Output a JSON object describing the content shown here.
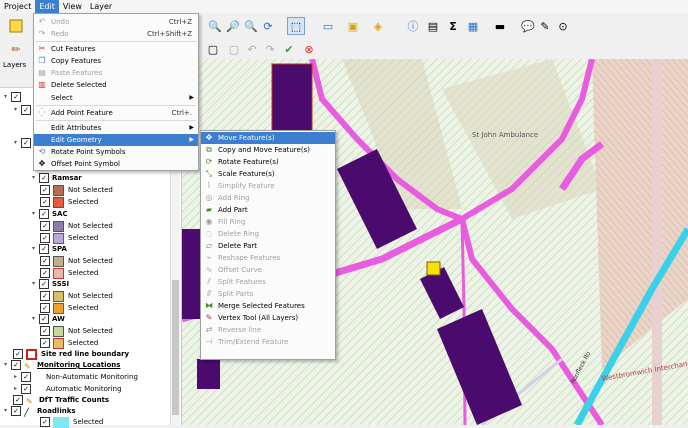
{
  "menubar": {
    "items": [
      "Project",
      "Edit",
      "View",
      "Layer"
    ]
  },
  "edit_menu": {
    "items": [
      {
        "label": "Undo",
        "shortcut": "Ctrl+Z"
      },
      {
        "label": "Redo",
        "shortcut": "Ctrl+Shift+Z"
      },
      {
        "label": "Cut Features",
        "shortcut": ""
      },
      {
        "label": "Copy Features",
        "shortcut": ""
      },
      {
        "label": "Paste Features",
        "shortcut": ""
      },
      {
        "label": "Delete Selected",
        "shortcut": ""
      },
      {
        "label": "Select",
        "shortcut": ""
      },
      {
        "label": "Add Point Feature",
        "shortcut": "Ctrl+."
      },
      {
        "label": "Edit Attributes",
        "shortcut": ""
      },
      {
        "label": "Edit Geometry",
        "shortcut": ""
      },
      {
        "label": "Rotate Point Symbols",
        "shortcut": ""
      },
      {
        "label": "Offset Point Symbol",
        "shortcut": ""
      }
    ]
  },
  "geometry_submenu": {
    "items": [
      "Move Feature(s)",
      "Copy and Move Feature(s)",
      "Rotate Feature(s)",
      "Scale Feature(s)",
      "Simplify Feature",
      "Add Ring",
      "Add Part",
      "Fill Ring",
      "Delete Ring",
      "Delete Part",
      "Reshape Features",
      "Offset Curve",
      "Split Features",
      "Split Parts",
      "Merge Selected Features",
      "Vertex Tool (All Layers)",
      "Reverse line",
      "Trim/Extend Feature"
    ]
  },
  "layers": {
    "title": "Layers",
    "groups": [
      {
        "name": "Ramsar",
        "not_selected": "Not Selected",
        "selected": "Selected"
      },
      {
        "name": "SAC",
        "not_selected": "Not Selected",
        "selected": "Selected"
      },
      {
        "name": "SPA",
        "not_selected": "Not Selected",
        "selected": "Selected"
      },
      {
        "name": "SSSI",
        "not_selected": "Not Selected",
        "selected": "Selected"
      },
      {
        "name": "AW",
        "not_selected": "Not Selected",
        "selected": "Selected"
      }
    ],
    "site_boundary": "Site red line boundary",
    "monitoring": "Monitoring Locations",
    "non_auto": "Non-Automatic Monitoring",
    "auto": "Automatic Monitoring",
    "dft": "DfT Traffic Counts",
    "roadlinks": "Roadlinks",
    "roadlinks_selected": "Selected"
  },
  "map_labels": {
    "ambulance": "St John Ambulance",
    "road": "Ronfleck Ro",
    "interchange": "Westbromwich Interchange"
  },
  "colors": {
    "accent": "#3c7fd1",
    "building": "#4b0a6e",
    "road": "#e85ce0",
    "cyan": "#3ad0e8",
    "hatch": "#c4dab4"
  }
}
